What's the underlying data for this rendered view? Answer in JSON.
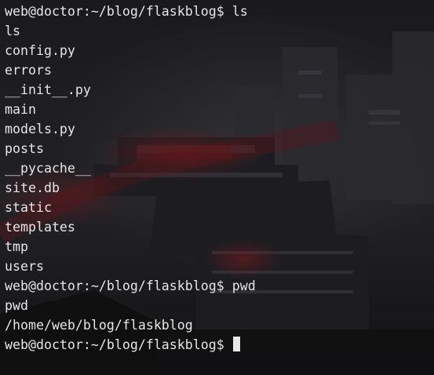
{
  "terminal": {
    "prompt": "web@doctor:~/blog/flaskblog$",
    "lines": [
      {
        "type": "prompt",
        "command": "ls"
      },
      {
        "type": "output",
        "text": "ls"
      },
      {
        "type": "output",
        "text": "config.py"
      },
      {
        "type": "output",
        "text": "errors"
      },
      {
        "type": "output",
        "text": "__init__.py"
      },
      {
        "type": "output",
        "text": "main"
      },
      {
        "type": "output",
        "text": "models.py"
      },
      {
        "type": "output",
        "text": "posts"
      },
      {
        "type": "output",
        "text": "__pycache__"
      },
      {
        "type": "output",
        "text": "site.db"
      },
      {
        "type": "output",
        "text": "static"
      },
      {
        "type": "output",
        "text": "templates"
      },
      {
        "type": "output",
        "text": "tmp"
      },
      {
        "type": "output",
        "text": "users"
      },
      {
        "type": "prompt",
        "command": "pwd"
      },
      {
        "type": "output",
        "text": "pwd"
      },
      {
        "type": "output",
        "text": "/home/web/blog/flaskblog"
      },
      {
        "type": "prompt",
        "command": ""
      }
    ],
    "colors": {
      "text": "#e6e6e6",
      "background": "#141416",
      "cursor": "#e8e8e8",
      "accent_red": "#8a1a1f"
    }
  }
}
